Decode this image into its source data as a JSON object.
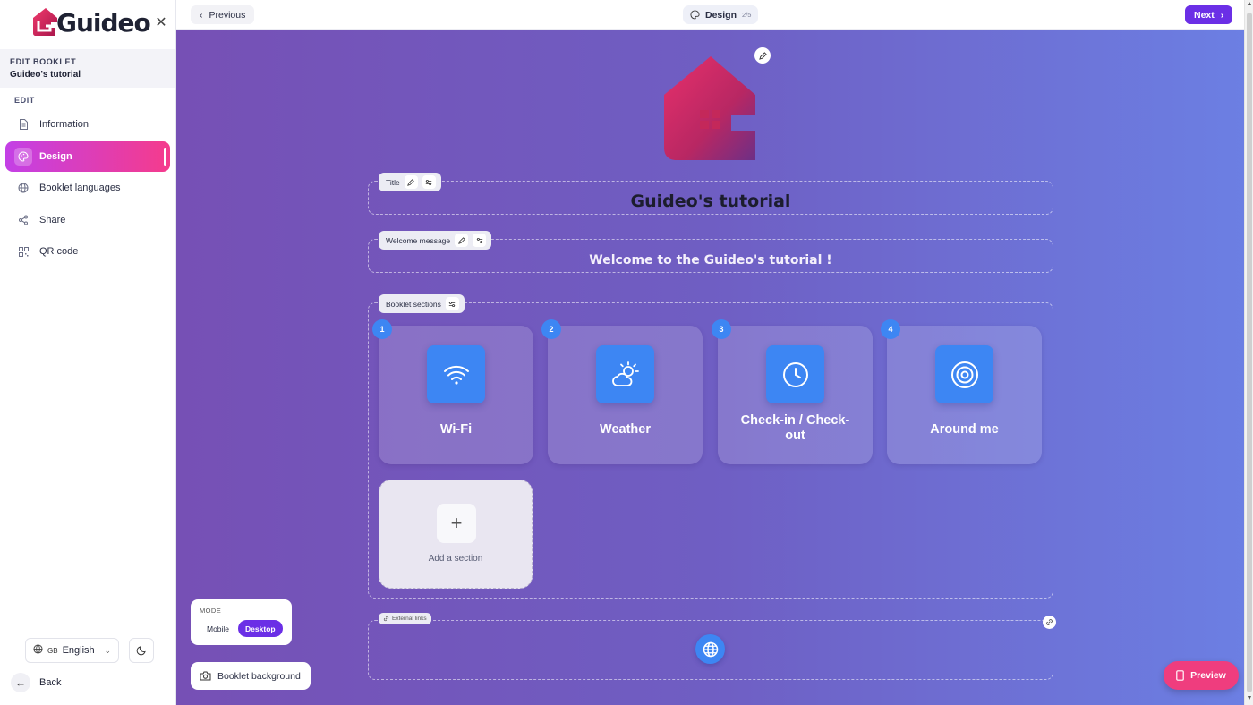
{
  "app": {
    "name": "Guideo"
  },
  "sidebar": {
    "booklet_caption": "EDIT BOOKLET",
    "booklet_name": "Guideo's tutorial",
    "edit_caption": "EDIT",
    "items": [
      {
        "label": "Information",
        "icon": "document-icon",
        "active": false
      },
      {
        "label": "Design",
        "icon": "palette-icon",
        "active": true
      },
      {
        "label": "Booklet languages",
        "icon": "globe-icon",
        "active": false
      },
      {
        "label": "Share",
        "icon": "share-icon",
        "active": false
      },
      {
        "label": "QR code",
        "icon": "qr-code-icon",
        "active": false
      }
    ],
    "language": {
      "flag": "GB",
      "label": "English"
    },
    "back_label": "Back"
  },
  "topbar": {
    "previous_label": "Previous",
    "step_label": "Design",
    "step_count": "2/5",
    "next_label": "Next"
  },
  "editor": {
    "title_tag": "Title",
    "title_text": "Guideo's tutorial",
    "welcome_tag": "Welcome message",
    "welcome_text": "Welcome to the Guideo's tutorial !",
    "sections_tag": "Booklet sections",
    "sections": [
      {
        "number": "1",
        "label": "Wi-Fi",
        "icon": "wifi-icon"
      },
      {
        "number": "2",
        "label": "Weather",
        "icon": "weather-icon"
      },
      {
        "number": "3",
        "label": "Check-in / Check-out",
        "icon": "clock-icon"
      },
      {
        "number": "4",
        "label": "Around me",
        "icon": "target-icon"
      }
    ],
    "add_section_label": "Add a section",
    "external_links_tag": "External links"
  },
  "controls": {
    "mode_caption": "MODE",
    "mode_options": [
      "Mobile",
      "Desktop"
    ],
    "mode_selected": "Desktop",
    "background_label": "Booklet background",
    "preview_label": "Preview"
  },
  "colors": {
    "brand_pink": "#ef3d7e",
    "accent_purple": "#6b2fe6",
    "section_blue": "#3d86f3"
  }
}
